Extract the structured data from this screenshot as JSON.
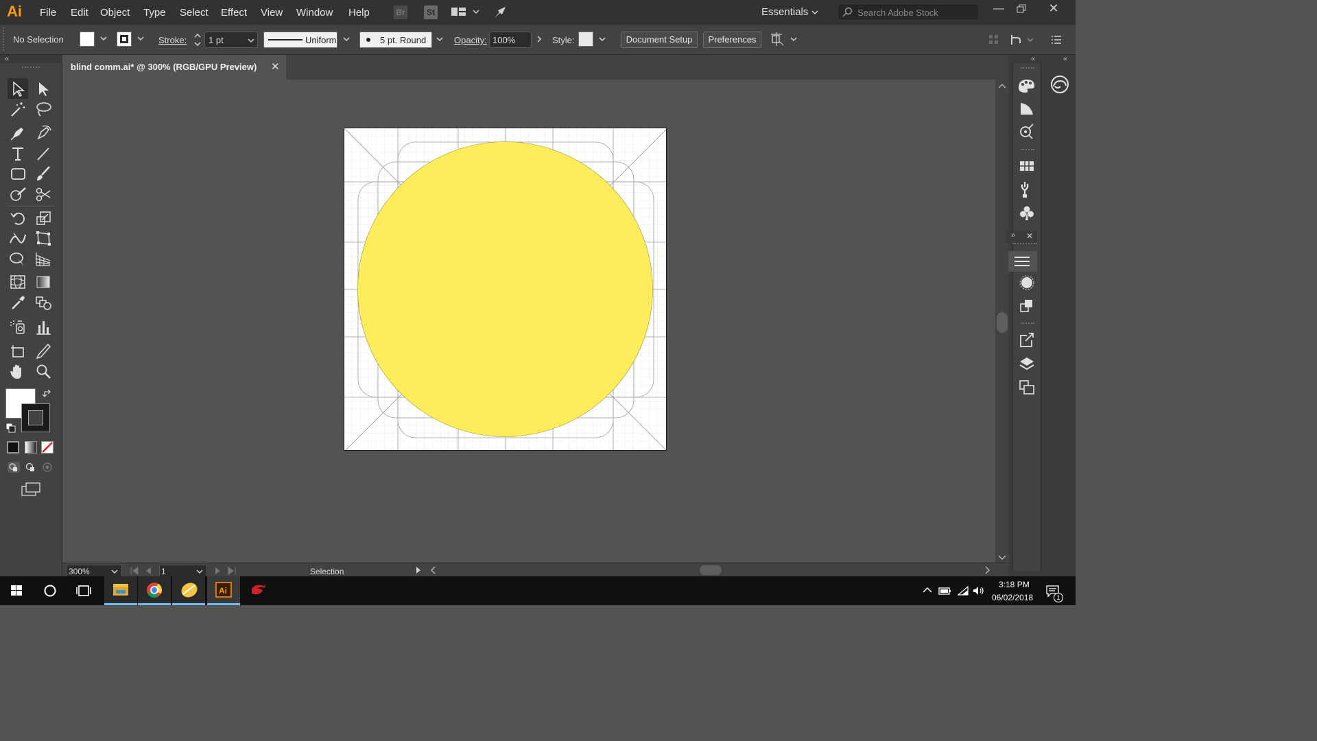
{
  "app": {
    "logo": "Ai",
    "menu": [
      "File",
      "Edit",
      "Object",
      "Type",
      "Select",
      "Effect",
      "View",
      "Window",
      "Help"
    ],
    "bridge_label": "Br",
    "stock_label": "St",
    "workspace": "Essentials",
    "search_placeholder": "Search Adobe Stock"
  },
  "control_bar": {
    "selection_status": "No Selection",
    "stroke_label": "Stroke:",
    "stroke_weight": "1 pt",
    "profile": "Uniform",
    "brush": "5 pt. Round",
    "opacity_label": "Opacity:",
    "opacity_value": "100%",
    "style_label": "Style:",
    "document_setup": "Document Setup",
    "preferences": "Preferences"
  },
  "document": {
    "tab_title": "blind comm.ai* @ 300% (RGB/GPU Preview)",
    "close_symbol": "✕",
    "artwork_fill": "#ffec5a"
  },
  "status_bar": {
    "zoom": "300%",
    "artboard_number": "1",
    "current_tool": "Selection"
  },
  "taskbar": {
    "time": "3:18 PM",
    "date": "06/02/2018",
    "notification_count": "1"
  }
}
